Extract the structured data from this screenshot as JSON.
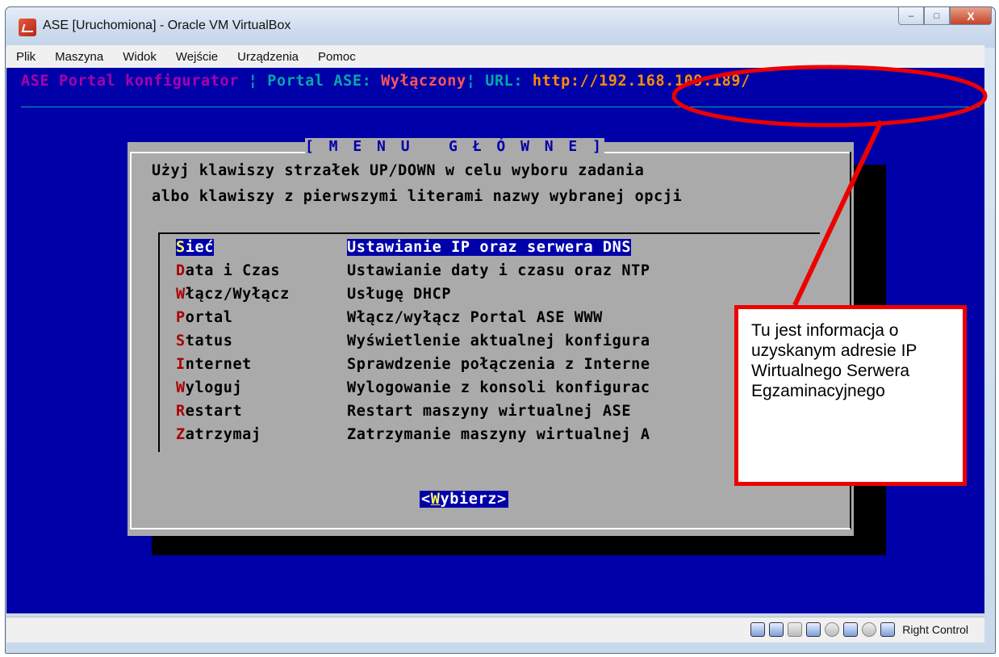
{
  "window": {
    "title": "ASE [Uruchomiona] - Oracle VM VirtualBox",
    "controls": {
      "minimize": "–",
      "maximize": "□",
      "close": "X"
    }
  },
  "menubar": [
    "Plik",
    "Maszyna",
    "Widok",
    "Wejście",
    "Urządzenia",
    "Pomoc"
  ],
  "console": {
    "header": {
      "app": "ASE Portal konfigurator",
      "sep1": " ¦ ",
      "portal_label": "Portal ASE: ",
      "portal_state": "Wyłączony",
      "sep2": "¦ ",
      "url_label": "URL: ",
      "url": "http://192.168.109.189/"
    },
    "menu": {
      "title": "[ M E N U   G Ł Ó W N E ]",
      "instruction_1": "Użyj klawiszy strzałek UP/DOWN w celu wyboru zadania",
      "instruction_2": "albo klawiszy z pierwszymi literami nazwy wybranej opcji",
      "items": [
        {
          "hot": "S",
          "rest": "ieć",
          "description": "Ustawianie IP oraz serwera DNS",
          "selected": true
        },
        {
          "hot": "D",
          "rest": "ata i Czas",
          "description": "Ustawianie daty i czasu oraz NTP"
        },
        {
          "hot": "W",
          "rest": "łącz/Wyłącz",
          "description": "Usługę DHCP"
        },
        {
          "hot": "P",
          "rest": "ortal",
          "description": "Włącz/wyłącz Portal ASE WWW"
        },
        {
          "hot": "S",
          "rest": "tatus",
          "description": "Wyświetlenie aktualnej konfigura"
        },
        {
          "hot": "I",
          "rest": "nternet",
          "description": "Sprawdzenie połączenia z Interne"
        },
        {
          "hot": "W",
          "rest": "yloguj",
          "description": "Wylogowanie z konsoli konfigurac"
        },
        {
          "hot": "R",
          "rest": "estart",
          "description": "Restart maszyny wirtualnej ASE"
        },
        {
          "hot": "Z",
          "rest": "atrzymaj",
          "description": "Zatrzymanie maszyny wirtualnej A"
        }
      ],
      "button": {
        "lt": "<",
        "hot": "W",
        "rest": "ybierz",
        "gt": ">"
      }
    }
  },
  "annotation": {
    "text": "Tu jest informacja o uzyskanym adresie IP Wirtualnego Serwera Egzaminacyjnego",
    "color": "#ee0000"
  },
  "statusbar": {
    "host_key": "Right Control",
    "icons": [
      "hard-disk-icon",
      "network-icon",
      "shared-folder-icon",
      "display-icon",
      "cd-icon",
      "usb-icon",
      "mouse-icon",
      "keyboard-icon"
    ]
  },
  "colors": {
    "vm_bg": "#0000a8",
    "dialog_bg": "#aaaaaa",
    "selection": "#0000aa",
    "hotkey": "#aa0000"
  }
}
